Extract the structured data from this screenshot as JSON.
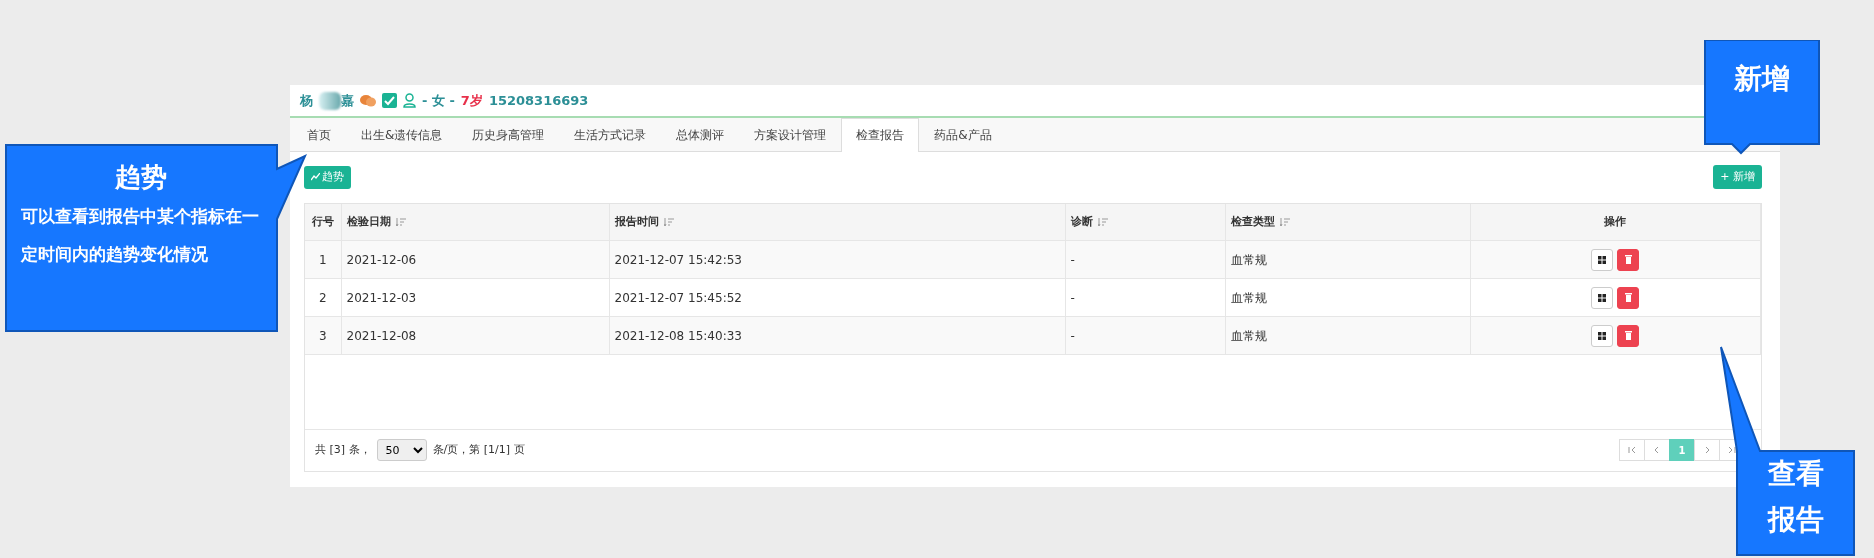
{
  "patient": {
    "name_start": "杨",
    "name_end": "嘉",
    "gender": "- 女 -",
    "age": "7岁",
    "phone": "15208316693"
  },
  "tabs": [
    {
      "label": "首页",
      "selected": false
    },
    {
      "label": "出生&遗传信息",
      "selected": false
    },
    {
      "label": "历史身高管理",
      "selected": false
    },
    {
      "label": "生活方式记录",
      "selected": false
    },
    {
      "label": "总体测评",
      "selected": false
    },
    {
      "label": "方案设计管理",
      "selected": false
    },
    {
      "label": "检查报告",
      "selected": true
    },
    {
      "label": "药品&产品",
      "selected": false
    }
  ],
  "toolbar": {
    "trend_button": "趋势",
    "add_button": "+ 新增"
  },
  "table": {
    "columns": [
      {
        "label": "行号",
        "sortable": false
      },
      {
        "label": "检验日期",
        "sortable": true
      },
      {
        "label": "报告时间",
        "sortable": true
      },
      {
        "label": "诊断",
        "sortable": true
      },
      {
        "label": "检查类型",
        "sortable": true
      },
      {
        "label": "操作",
        "sortable": false
      }
    ],
    "rows": [
      [
        "1",
        "2021-12-06",
        "2021-12-07 15:42:53",
        "-",
        "血常规"
      ],
      [
        "2",
        "2021-12-03",
        "2021-12-07 15:45:52",
        "-",
        "血常规"
      ],
      [
        "3",
        "2021-12-08",
        "2021-12-08 15:40:33",
        "-",
        "血常规"
      ]
    ]
  },
  "footer": {
    "total": "共 [3] 条，",
    "page_size": "50",
    "page_info": "条/页，第 [1/1] 页",
    "pages": [
      {
        "kind": "first",
        "selected": false
      },
      {
        "kind": "prev",
        "selected": false
      },
      {
        "kind": "number",
        "label": "1",
        "selected": true
      },
      {
        "kind": "next",
        "selected": false
      },
      {
        "kind": "last",
        "selected": false
      }
    ]
  },
  "callouts": [
    {
      "kind": "left",
      "title": "趋势",
      "body": "可以查看到报告中某个指标在一定时间内的趋势变化情况"
    },
    {
      "kind": "top",
      "title": "新增"
    },
    {
      "kind": "bottom",
      "title": "查看报告"
    }
  ]
}
